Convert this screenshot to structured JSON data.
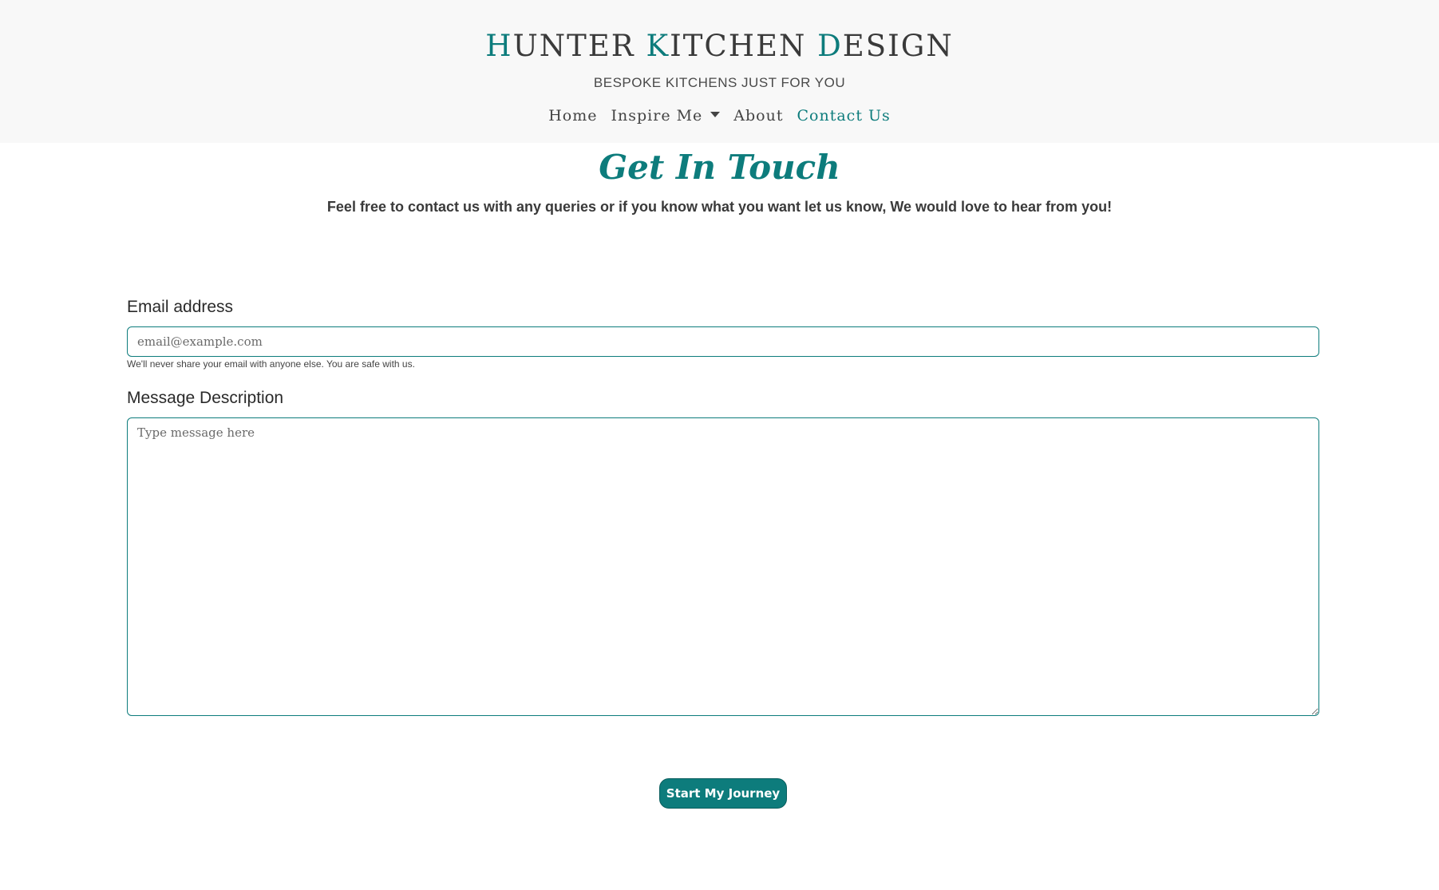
{
  "header": {
    "brand": {
      "word1_initial": "H",
      "word1_rest": "UNTER",
      "word2_initial": "K",
      "word2_rest": "ITCHEN",
      "word3_initial": "D",
      "word3_rest": "ESIGN"
    },
    "tagline": "BESPOKE KITCHENS JUST FOR YOU",
    "nav": {
      "home": "Home",
      "inspire": "Inspire Me",
      "about": "About",
      "contact": "Contact Us",
      "active": "contact"
    }
  },
  "main": {
    "heading": "Get In Touch",
    "intro": "Feel free to contact us with any queries or if you know what you want let us know, We would love to hear from you!"
  },
  "form": {
    "email_label": "Email address",
    "email_placeholder": "email@example.com",
    "email_value": "",
    "email_help": "We'll never share your email with anyone else. You are safe with us.",
    "message_label": "Message Description",
    "message_placeholder": "Type message here",
    "message_value": "",
    "submit_label": "Start My Journey"
  },
  "colors": {
    "accent": "#0d7c7c",
    "header_bg": "#f8f8f8",
    "text": "#333333"
  },
  "icons": {
    "inspire_dropdown": "caret-down-icon"
  }
}
